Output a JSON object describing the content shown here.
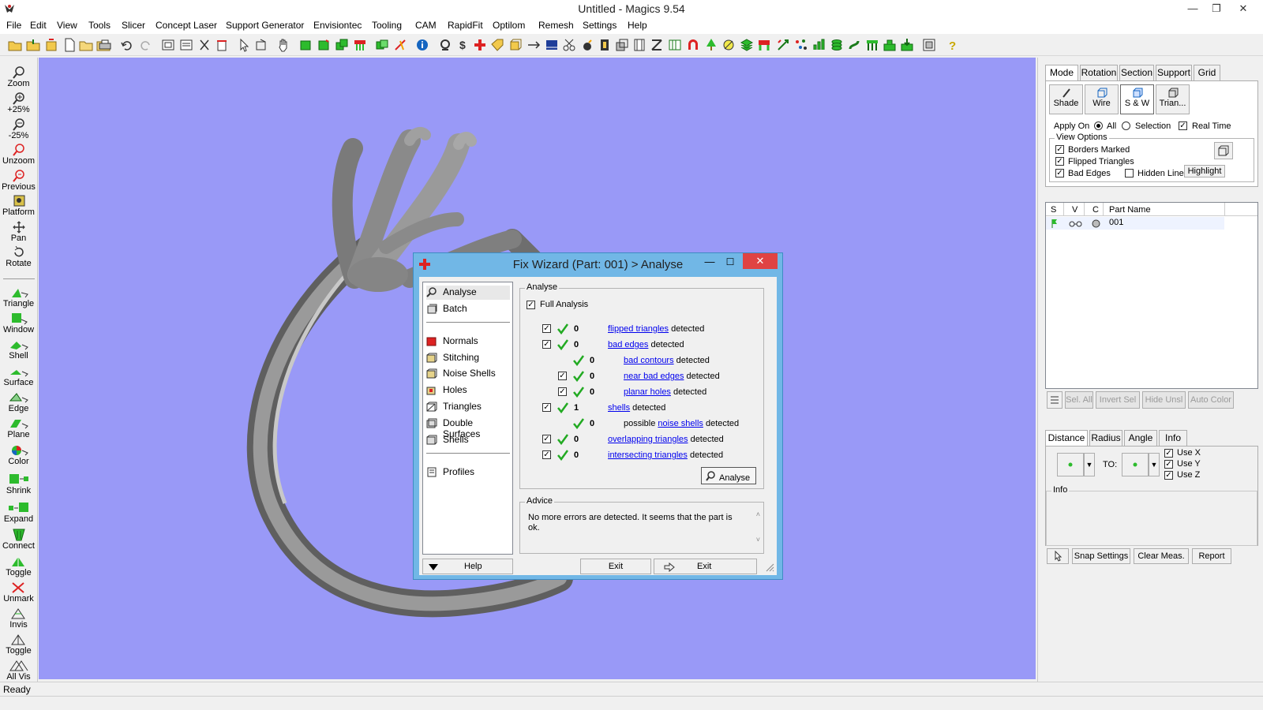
{
  "window": {
    "title": "Untitled - Magics 9.54"
  },
  "menu": [
    "File",
    "Edit",
    "View",
    "Tools",
    "Slicer",
    "Concept Laser",
    "Support Generator",
    "Envisiontec",
    "Tooling",
    "CAM",
    "RapidFit",
    "Optilom",
    "Remesh",
    "Settings",
    "Help"
  ],
  "left_tools": {
    "view": [
      {
        "label": "Zoom",
        "icon": "magnifier-icon"
      },
      {
        "label": "+25%",
        "icon": "zoom-in-icon"
      },
      {
        "label": "-25%",
        "icon": "zoom-out-icon"
      },
      {
        "label": "Unzoom",
        "icon": "unzoom-icon"
      },
      {
        "label": "Previous",
        "icon": "previous-view-icon"
      },
      {
        "label": "Platform",
        "icon": "platform-icon"
      },
      {
        "label": "Pan",
        "icon": "pan-icon"
      },
      {
        "label": "Rotate",
        "icon": "rotate-icon"
      }
    ],
    "mark": [
      {
        "label": "Triangle",
        "icon": "mark-triangle-icon"
      },
      {
        "label": "Window",
        "icon": "mark-window-icon"
      },
      {
        "label": "Shell",
        "icon": "mark-shell-icon"
      },
      {
        "label": "Surface",
        "icon": "mark-surface-icon"
      },
      {
        "label": "Edge",
        "icon": "mark-edge-icon"
      },
      {
        "label": "Plane",
        "icon": "mark-plane-icon"
      },
      {
        "label": "Color",
        "icon": "mark-color-icon"
      },
      {
        "label": "Shrink",
        "icon": "shrink-icon"
      },
      {
        "label": "Expand",
        "icon": "expand-icon"
      },
      {
        "label": "Connect",
        "icon": "connect-icon"
      },
      {
        "label": "Toggle",
        "icon": "toggle-mark-icon"
      },
      {
        "label": "Unmark",
        "icon": "unmark-icon"
      },
      {
        "label": "Invis",
        "icon": "invisible-icon"
      },
      {
        "label": "Toggle",
        "icon": "toggle-visible-icon"
      },
      {
        "label": "All Vis",
        "icon": "all-visible-icon"
      }
    ]
  },
  "right_panel": {
    "view_tabs": [
      "Mode",
      "Rotation",
      "Section",
      "Support",
      "Grid"
    ],
    "modes": [
      "Shade",
      "Wire",
      "S & W",
      "Trian..."
    ],
    "apply_on_label": "Apply On",
    "apply_all": "All",
    "apply_selection": "Selection",
    "real_time": "Real Time",
    "view_options_title": "View Options",
    "borders_marked": "Borders Marked",
    "flipped_triangles": "Flipped Triangles",
    "bad_edges": "Bad Edges",
    "hidden_line": "Hidden Line",
    "highlight": "Highlight",
    "parts_columns": [
      "S",
      "V",
      "C",
      "Part Name"
    ],
    "parts": [
      {
        "name": "001"
      }
    ],
    "part_buttons": [
      "Sel. All",
      "Invert Sel",
      "Hide Unsl",
      "Auto Color"
    ],
    "measure_tabs": [
      "Distance",
      "Radius",
      "Angle",
      "Info"
    ],
    "to_label": "TO:",
    "use_x": "Use X",
    "use_y": "Use Y",
    "use_z": "Use Z",
    "info_title": "Info",
    "measure_buttons": [
      "Snap Settings",
      "Clear Meas.",
      "Report"
    ]
  },
  "status": {
    "text": "Ready"
  },
  "dialog": {
    "title": "Fix Wizard (Part: 001) > Analyse",
    "list_top": [
      {
        "label": "Analyse",
        "icon": "magnifier-icon"
      },
      {
        "label": "Batch",
        "icon": "batch-icon"
      }
    ],
    "list_mid": [
      {
        "label": "Normals",
        "icon": "normals-icon"
      },
      {
        "label": "Stitching",
        "icon": "stitching-icon"
      },
      {
        "label": "Noise Shells",
        "icon": "noise-shells-icon"
      },
      {
        "label": "Holes",
        "icon": "holes-icon"
      },
      {
        "label": "Triangles",
        "icon": "triangles-icon"
      },
      {
        "label": "Double Surfaces",
        "icon": "double-surfaces-icon"
      },
      {
        "label": "Shells",
        "icon": "shells-icon"
      }
    ],
    "list_bottom": [
      {
        "label": "Profiles",
        "icon": "profiles-icon"
      }
    ],
    "analyse_title": "Analyse",
    "full_analysis": "Full Analysis",
    "rows": [
      {
        "prefix": "",
        "link": "flipped triangles",
        "suffix": " detected",
        "count": "0",
        "checkbox": true,
        "indent": 0
      },
      {
        "prefix": "",
        "link": "bad edges",
        "suffix": " detected",
        "count": "0",
        "checkbox": true,
        "indent": 0
      },
      {
        "prefix": "",
        "link": "bad contours",
        "suffix": " detected",
        "count": "0",
        "checkbox": false,
        "indent": 1
      },
      {
        "prefix": "",
        "link": "near bad edges",
        "suffix": " detected",
        "count": "0",
        "checkbox": true,
        "indent": 1
      },
      {
        "prefix": "",
        "link": "planar holes",
        "suffix": " detected",
        "count": "0",
        "checkbox": true,
        "indent": 1
      },
      {
        "prefix": "",
        "link": "shells",
        "suffix": " detected",
        "count": "1",
        "checkbox": true,
        "indent": 0
      },
      {
        "prefix": "possible ",
        "link": "noise shells",
        "suffix": " detected",
        "count": "0",
        "checkbox": false,
        "indent": 1
      },
      {
        "prefix": "",
        "link": "overlapping triangles",
        "suffix": " detected",
        "count": "0",
        "checkbox": true,
        "indent": 0
      },
      {
        "prefix": "",
        "link": "intersecting triangles",
        "suffix": " detected",
        "count": "0",
        "checkbox": true,
        "indent": 0
      }
    ],
    "analyse_button": "Analyse",
    "advice_title": "Advice",
    "advice_text": "No more errors are detected. It seems that the part is ok.",
    "help": "Help",
    "exit1": "Exit",
    "exit2": "Exit"
  },
  "colors": {
    "viewport": "#9999f7",
    "dialog_frame": "#71b7e6",
    "close": "#e04343",
    "check": "#22aa22",
    "link": "#0000ee"
  }
}
